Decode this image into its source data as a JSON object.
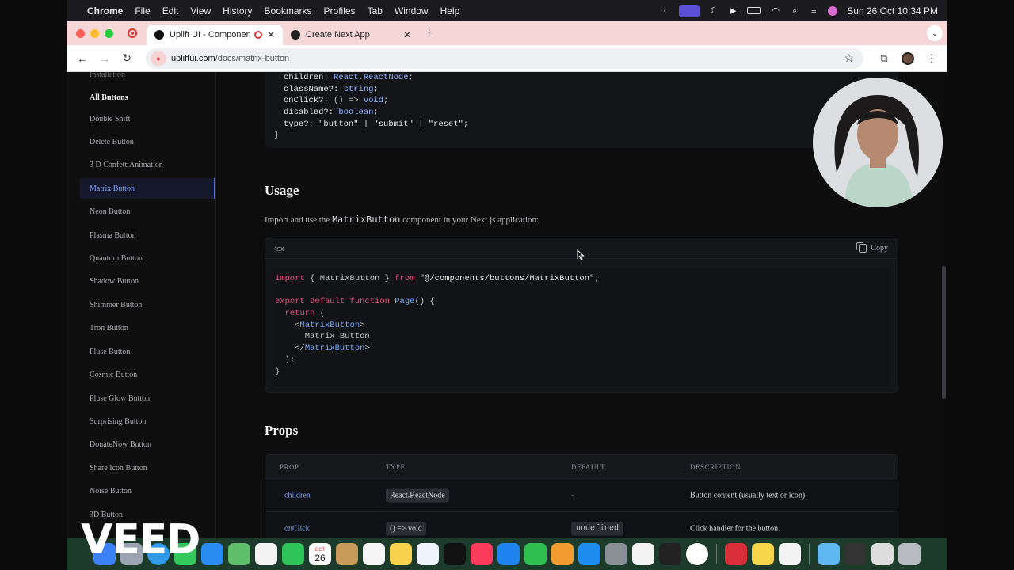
{
  "menubar": {
    "app_name": "Chrome",
    "items": [
      "File",
      "Edit",
      "View",
      "History",
      "Bookmarks",
      "Profiles",
      "Tab",
      "Window",
      "Help"
    ],
    "clock": "Sun 26 Oct  10:34 PM"
  },
  "browser": {
    "tabs": [
      {
        "title": "Uplift UI - Component Lib",
        "close": "✕"
      },
      {
        "title": "Create Next App",
        "close": "✕"
      }
    ],
    "new_tab": "+",
    "url_domain": "upliftui.com",
    "url_path": "/docs/matrix-button"
  },
  "sidebar": {
    "top_item": "Installation",
    "section_title": "All Buttons",
    "items": [
      "Double Shift",
      "Delete Button",
      "3 D ConfettiAnimation",
      "Matrix Button",
      "Neon Button",
      "Plasma Button",
      "Quantum Button",
      "Shadow Button",
      "Shimmer Button",
      "Tron Button",
      "Pluse Button",
      "Cosmic Button",
      "Pluse Glow Button",
      "Surprising Button",
      "DonateNow Button",
      "Share Icon Button",
      "Noise Button",
      "3D Button"
    ],
    "active_item": "Matrix Button"
  },
  "interface_code": {
    "lines": [
      [
        [
          "prop",
          "children: "
        ],
        [
          "type",
          "React.ReactNode"
        ],
        [
          "punc",
          ";"
        ]
      ],
      [
        [
          "prop",
          "className?: "
        ],
        [
          "type",
          "string"
        ],
        [
          "punc",
          ";"
        ]
      ],
      [
        [
          "prop",
          "onClick?: "
        ],
        [
          "punc",
          "() => "
        ],
        [
          "type",
          "void"
        ],
        [
          "punc",
          ";"
        ]
      ],
      [
        [
          "prop",
          "disabled?: "
        ],
        [
          "type",
          "boolean"
        ],
        [
          "punc",
          ";"
        ]
      ],
      [
        [
          "prop",
          "type?: "
        ],
        [
          "str",
          "\"button\" | \"submit\" | \"reset\""
        ],
        [
          "punc",
          ";"
        ]
      ],
      [
        [
          "punc",
          "}"
        ]
      ]
    ]
  },
  "usage": {
    "heading": "Usage",
    "intro_before": "Import and use the ",
    "intro_code": "MatrixButton",
    "intro_after": " component in your Next.js application:",
    "lang": "tsx",
    "copy_label": "Copy",
    "code_lines": [
      [
        [
          "kw",
          "import"
        ],
        [
          "punc",
          " { MatrixButton } "
        ],
        [
          "kw",
          "from"
        ],
        [
          "str",
          " \"@/components/buttons/MatrixButton\""
        ],
        [
          "punc",
          ";"
        ]
      ],
      [
        [
          "punc",
          " "
        ]
      ],
      [
        [
          "kw",
          "export default function "
        ],
        [
          "fn",
          "Page"
        ],
        [
          "punc",
          "() {"
        ]
      ],
      [
        [
          "kw",
          "  return"
        ],
        [
          "punc",
          " ("
        ]
      ],
      [
        [
          "punc",
          "    <"
        ],
        [
          "tag",
          "MatrixButton"
        ],
        [
          "punc",
          ">"
        ]
      ],
      [
        [
          "punc",
          "      Matrix Button"
        ]
      ],
      [
        [
          "punc",
          "    </"
        ],
        [
          "tag",
          "MatrixButton"
        ],
        [
          "punc",
          ">"
        ]
      ],
      [
        [
          "punc",
          "  );"
        ]
      ],
      [
        [
          "punc",
          "}"
        ]
      ]
    ]
  },
  "props": {
    "heading": "Props",
    "columns": [
      "PROP",
      "TYPE",
      "DEFAULT",
      "DESCRIPTION"
    ],
    "rows": [
      {
        "prop": "children",
        "type": "React.ReactNode",
        "default": "-",
        "description": "Button content (usually text or icon)."
      },
      {
        "prop": "onClick",
        "type": "() => void",
        "default": "undefined",
        "description": "Click handler for the button."
      }
    ]
  },
  "dock": {
    "calendar_month": "OCT",
    "calendar_day": "26"
  },
  "watermark": "VEED",
  "colors": {
    "accent": "#4f6ee8",
    "active_text": "#7c9ff5",
    "keyword": "#e05580",
    "type": "#8fb5ff"
  }
}
